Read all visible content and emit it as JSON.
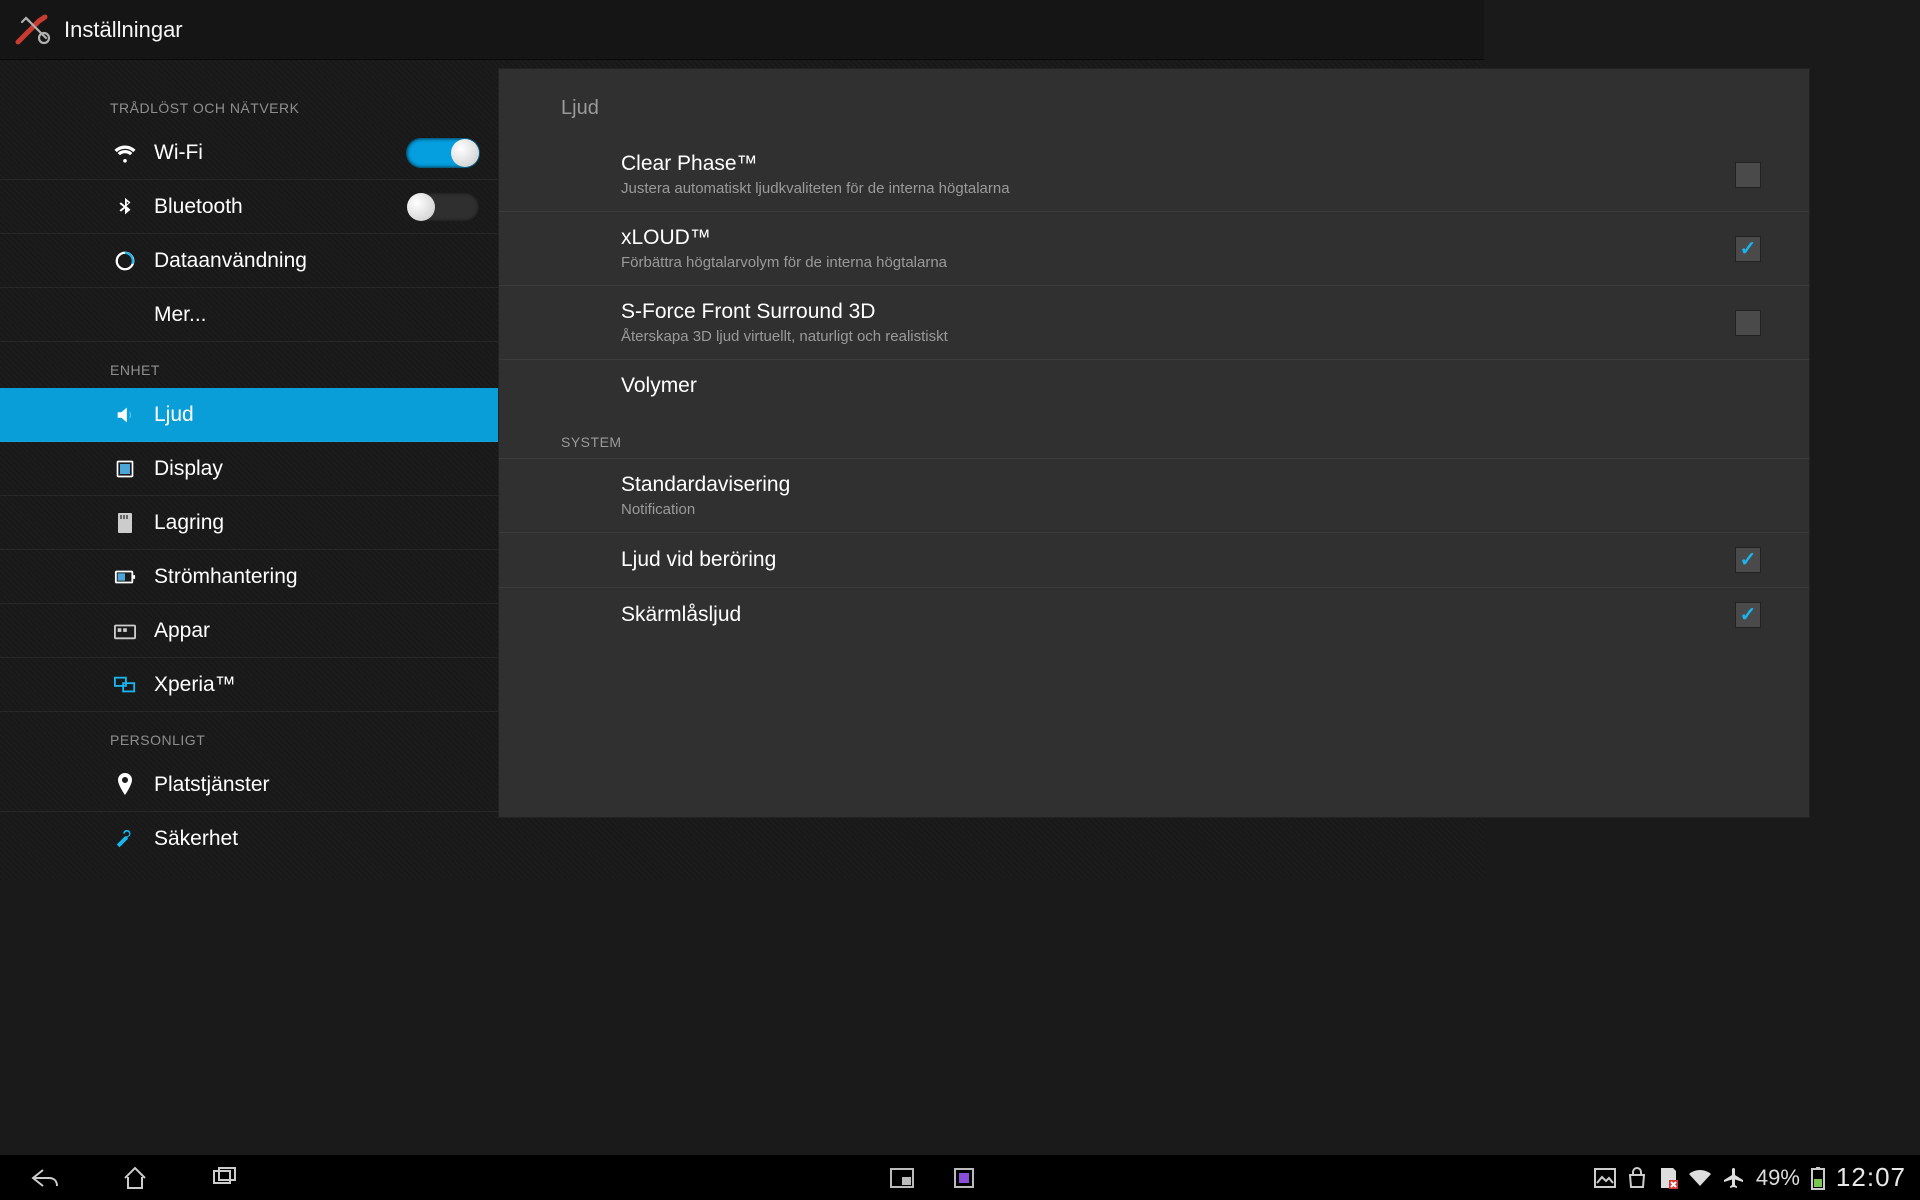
{
  "app": {
    "title": "Inställningar"
  },
  "sidebar": {
    "sections": {
      "wireless_header": "TRÅDLÖST OCH NÄTVERK",
      "device_header": "ENHET",
      "personal_header": "PERSONLIGT"
    },
    "wifi": {
      "label": "Wi-Fi",
      "on": true
    },
    "bluetooth": {
      "label": "Bluetooth",
      "on": false
    },
    "datausage": {
      "label": "Dataanvändning"
    },
    "more": {
      "label": "Mer..."
    },
    "sound": {
      "label": "Ljud"
    },
    "display": {
      "label": "Display"
    },
    "storage": {
      "label": "Lagring"
    },
    "power": {
      "label": "Strömhantering"
    },
    "apps": {
      "label": "Appar"
    },
    "xperia": {
      "label": "Xperia™"
    },
    "location": {
      "label": "Platstjänster"
    },
    "security": {
      "label": "Säkerhet"
    }
  },
  "detail": {
    "title": "Ljud",
    "clearphase": {
      "title": "Clear Phase™",
      "sub": "Justera automatiskt ljudkvaliteten för de interna högtalarna",
      "checked": false
    },
    "xloud": {
      "title": "xLOUD™",
      "sub": "Förbättra högtalarvolym för de interna högtalarna",
      "checked": true
    },
    "sforce": {
      "title": "S-Force Front Surround 3D",
      "sub": "Återskapa 3D ljud virtuellt, naturligt och realistiskt",
      "checked": false
    },
    "volumes": {
      "title": "Volymer"
    },
    "system_header": "SYSTEM",
    "default_notif": {
      "title": "Standardavisering",
      "sub": "Notification"
    },
    "touch_sound": {
      "title": "Ljud vid beröring",
      "checked": true
    },
    "lock_sound": {
      "title": "Skärmlåsljud",
      "checked": true
    }
  },
  "navbar": {
    "battery_pct": "49%",
    "clock": "12:07"
  },
  "colors": {
    "accent": "#0a9ed8"
  }
}
